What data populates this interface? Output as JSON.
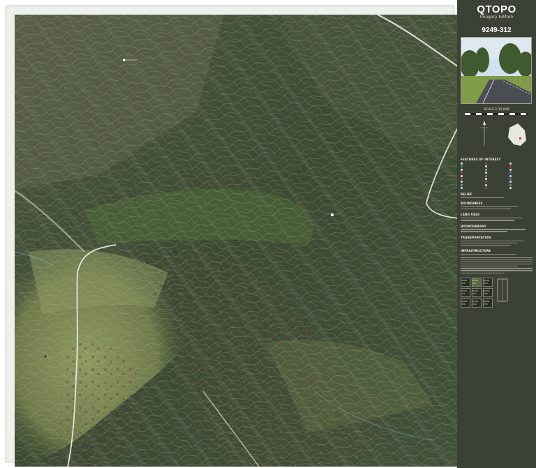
{
  "header": {
    "brand": "QTOPO",
    "edition": "Imagery Edition",
    "sheet_number": "9249-312"
  },
  "scale": {
    "label": "SCALE 1:15,000"
  },
  "map": {
    "marker_1": "",
    "marker_2": ""
  },
  "legend": {
    "features_title": "FEATURES OF INTEREST",
    "relief_title": "RELIEF",
    "boundaries_title": "BOUNDARIES",
    "land_uses_title": "LAND USES",
    "hydrography_title": "HYDROGRAPHY",
    "transportation_title": "TRANSPORTATION",
    "infrastructure_title": "INFRASTRUCTURE"
  },
  "colors": {
    "sidebar_bg": "#3c4136",
    "forest_dark": "#3a4a30",
    "pasture": "#7d8a58",
    "road": "#d9dad6",
    "water": "#6fa7c7",
    "contour": "#c7b38d"
  },
  "index_sheets": [
    {
      "id": "9249-311"
    },
    {
      "id": "9249-312"
    },
    {
      "id": "9249-313"
    },
    {
      "id": "9249-321"
    },
    {
      "id": "9249-322"
    },
    {
      "id": "9249-323"
    },
    {
      "id": "9249-331"
    },
    {
      "id": "9249-332"
    },
    {
      "id": "9249-333"
    }
  ]
}
